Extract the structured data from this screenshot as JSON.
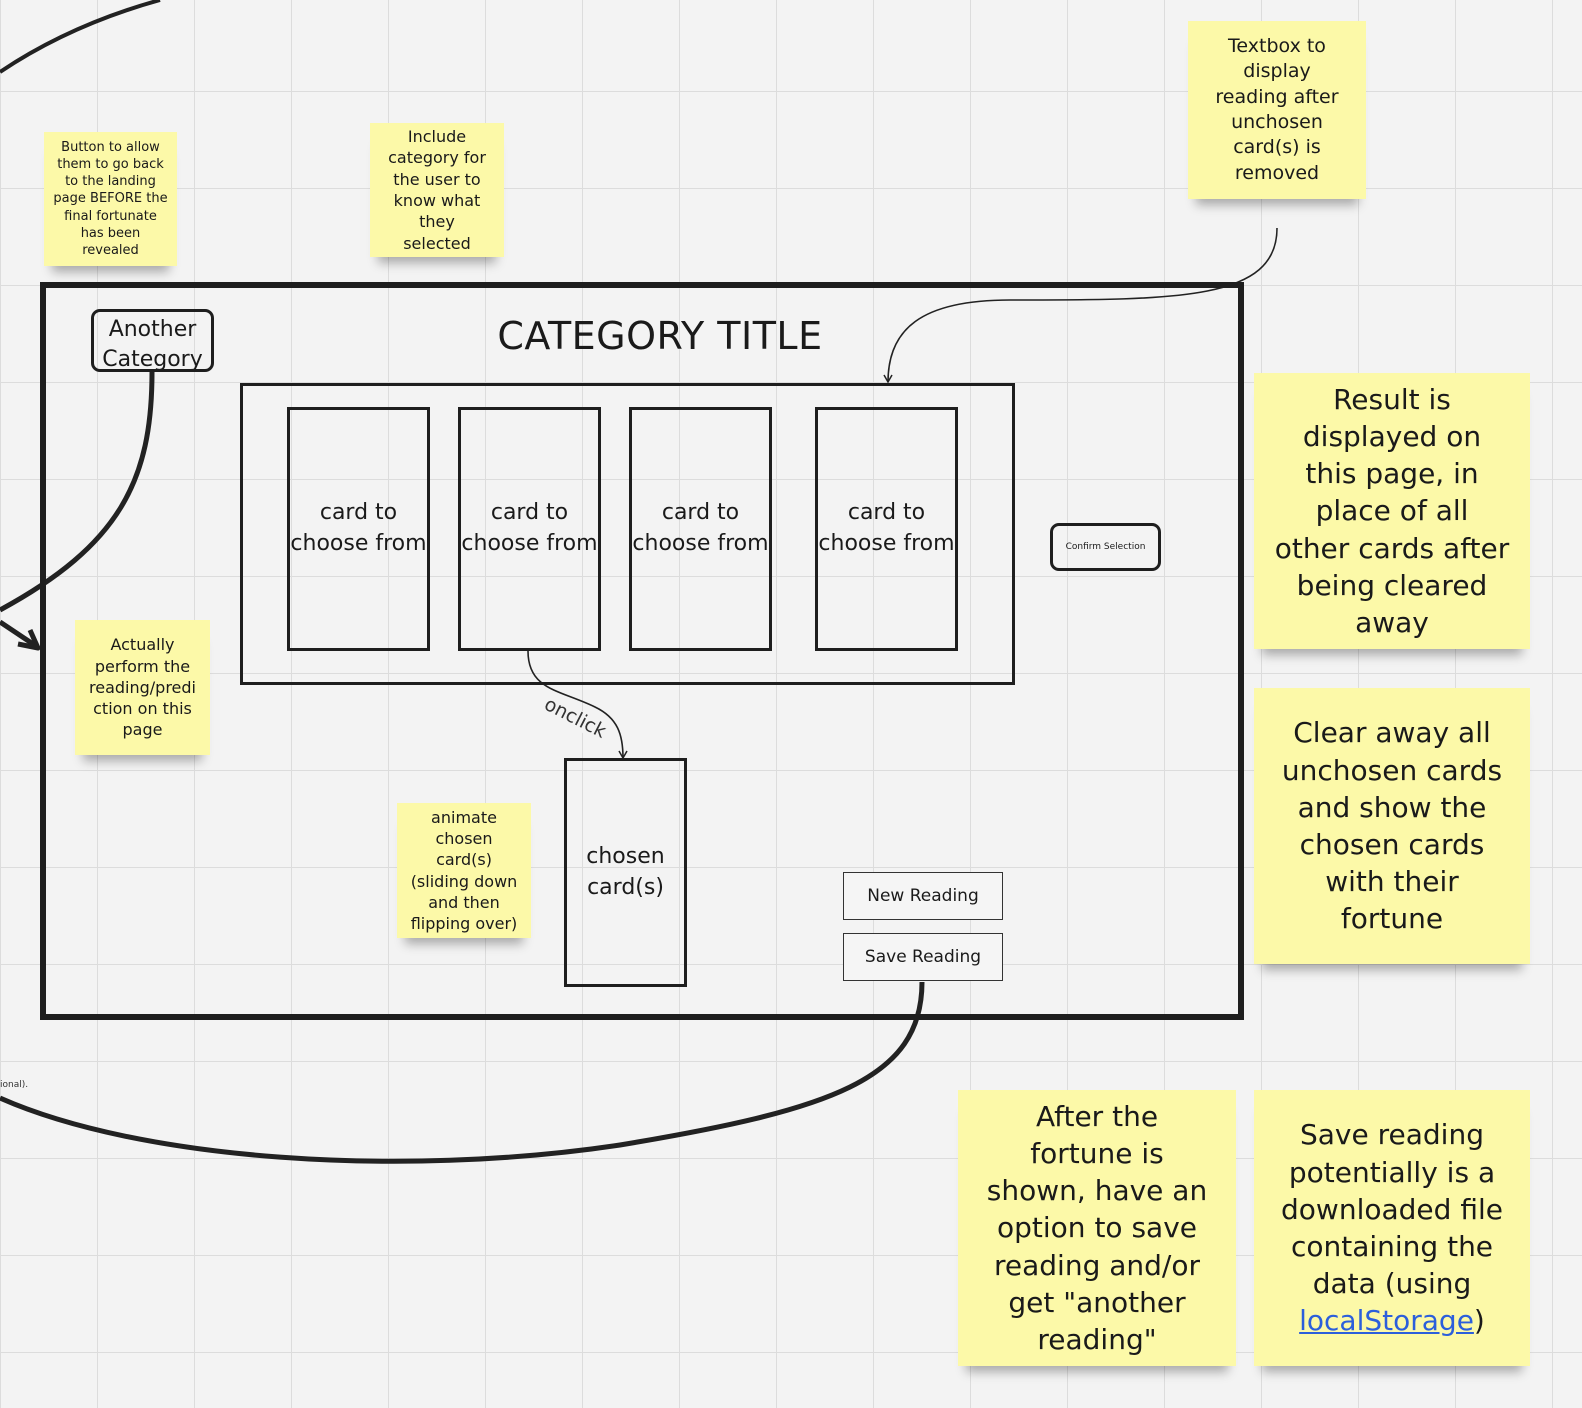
{
  "frame": {
    "title": "CATEGORY TITLE",
    "another_category_label": "Another Category",
    "cards": [
      "card to choose from",
      "card to choose from",
      "card to choose from",
      "card to choose from"
    ],
    "confirm_label": "Confirm Selection",
    "chosen_card_label": "chosen card(s)",
    "new_reading_label": "New Reading",
    "save_reading_label": "Save Reading"
  },
  "connector_labels": {
    "onclick": "onclick",
    "clipped_left_text": "ional)."
  },
  "notes": {
    "back_button": "Button to allow them to go back to the landing page BEFORE the final fortunate has been revealed",
    "include_category": "Include category for the user to know what they selected",
    "textbox": "Textbox to display reading after unchosen card(s) is removed",
    "perform_reading": "Actually perform the reading/prediction on this page",
    "animate": "animate chosen card(s) (sliding down and then flipping over)",
    "result_displayed": "Result is displayed on this page, in place of all other cards after being cleared away",
    "clear_away": "Clear away all unchosen cards and show the chosen cards with their fortune",
    "after_fortune": "After the fortune is shown, have an option to save reading and/or get \"another reading\"",
    "save_reading_prefix": "Save reading potentially is a downloaded file containing the data (using ",
    "save_reading_link": "localStorage",
    "save_reading_suffix": ")"
  },
  "colors": {
    "sticky": "#fcf9a8",
    "stroke": "#1e1e1e",
    "link": "#2c5fdb"
  }
}
